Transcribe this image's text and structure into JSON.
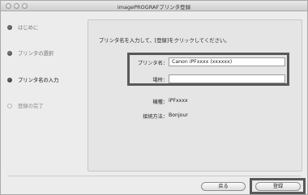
{
  "window": {
    "title": "imagePROGRAFプリンタ登録"
  },
  "steps": [
    {
      "label": "はじめに",
      "state": "done"
    },
    {
      "label": "プリンタの選択",
      "state": "done"
    },
    {
      "label": "プリンタ名の入力",
      "state": "current"
    },
    {
      "label": "登録の完了",
      "state": "pending"
    }
  ],
  "main": {
    "instruction": "プリンタ名を入力して、[登録]をクリックしてください。",
    "printer_name": {
      "label": "プリンタ名：",
      "value": "Canon iPFxxxx (xxxxxx)"
    },
    "location": {
      "label": "場所：",
      "value": ""
    },
    "model": {
      "label": "機種：",
      "value": "iPFxxxx"
    },
    "connection": {
      "label": "接続方法：",
      "value": "Bonjour"
    }
  },
  "buttons": {
    "back": "戻る",
    "register": "登録"
  }
}
